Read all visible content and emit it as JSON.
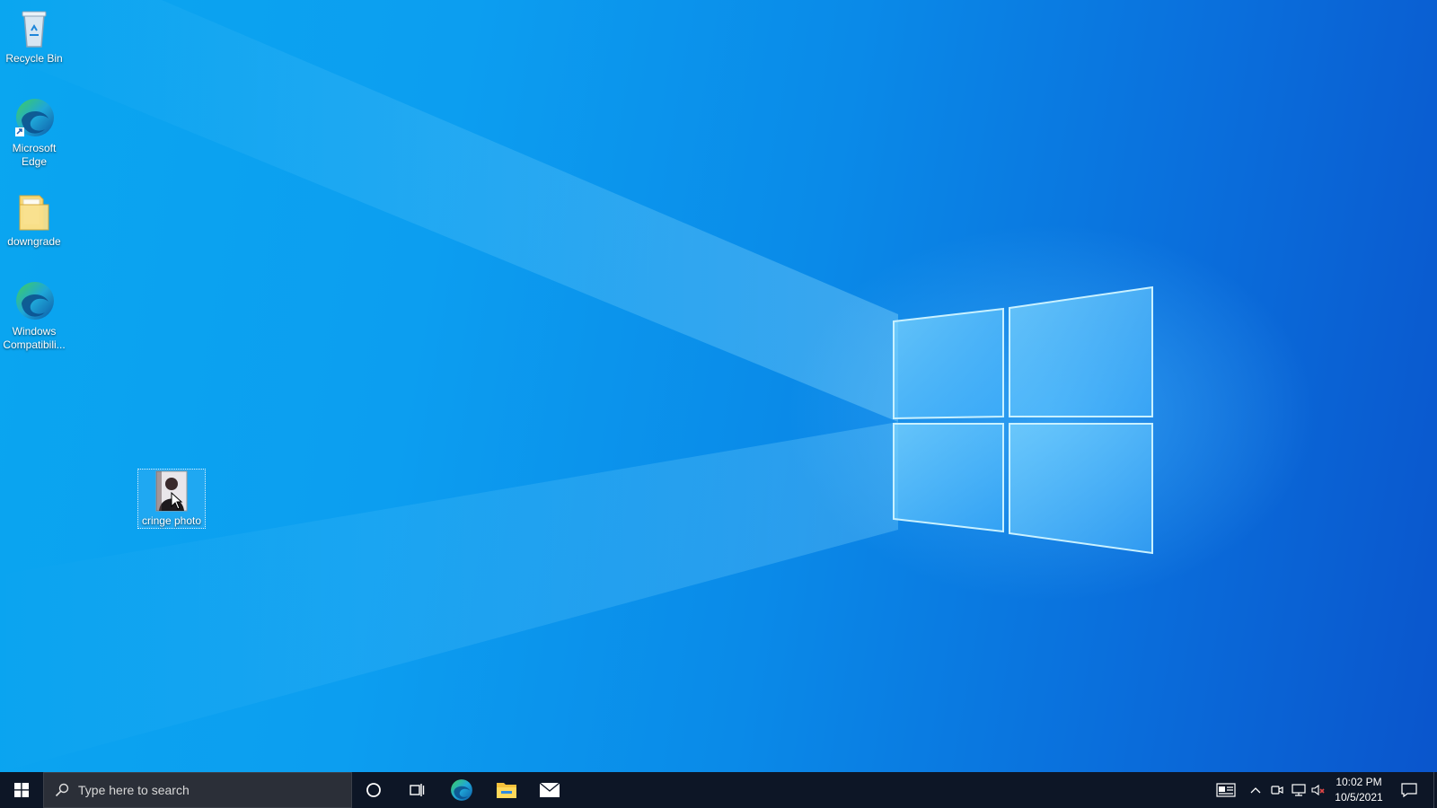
{
  "desktop": {
    "icons": [
      {
        "label": "Recycle Bin",
        "icon": "recycle-bin-icon"
      },
      {
        "label": "Microsoft Edge",
        "icon": "edge-icon"
      },
      {
        "label": "downgrade",
        "icon": "folder-icon"
      },
      {
        "label": "Windows Compatibili...",
        "icon": "edge-icon"
      },
      {
        "label": "cringe photo",
        "icon": "photo-thumbnail-icon",
        "selected": true
      }
    ]
  },
  "taskbar": {
    "search_placeholder": "Type here to search",
    "pinned": [
      "cortana-icon",
      "task-view-icon",
      "edge-icon",
      "file-explorer-icon",
      "mail-icon"
    ],
    "tray": [
      "news-icon",
      "chevron-up-icon",
      "meet-now-icon",
      "network-icon",
      "volume-muted-icon"
    ],
    "clock": {
      "time": "10:02 PM",
      "date": "10/5/2021"
    }
  },
  "colors": {
    "wallpaper_left": "#0aa6f0",
    "wallpaper_right": "#0a55cc",
    "taskbar": "#0d1626",
    "search_box": "#2b2f38"
  }
}
